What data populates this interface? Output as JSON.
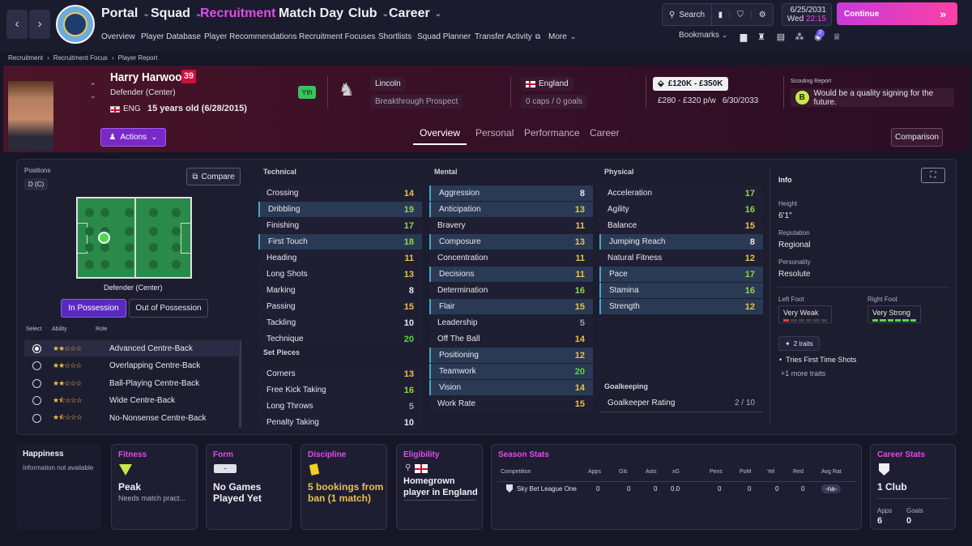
{
  "topnav": {
    "items": [
      "Portal",
      "Squad",
      "Recruitment",
      "Match Day",
      "Club",
      "Career"
    ],
    "subitems": [
      "Overview",
      "Player Database",
      "Player Recommendations",
      "Recruitment Focuses",
      "Shortlists",
      "Squad Planner",
      "Transfer Activity",
      "More"
    ],
    "search": "Search",
    "date": "6/25/2031",
    "day": "Wed",
    "time": "22:15",
    "continue": "Continue",
    "bookmarks": "Bookmarks",
    "badge": "2"
  },
  "breadcrumb": [
    "Recruitment",
    "Recruitment Focus",
    "Player Report"
  ],
  "player": {
    "name": "Harry Harwood",
    "number": "39",
    "position": "Defender (Center)",
    "nation_code": "ENG",
    "age": "15 years old (6/28/2015)",
    "youth_tag": "Yth",
    "club": "Lincoln",
    "status": "Breakthrough Prospect",
    "nation": "England",
    "caps": "0 caps / 0 goals",
    "value": "£120K - £350K",
    "wage": "£280 - £320 p/w",
    "contract": "6/30/2033",
    "actions": "Actions"
  },
  "scout": {
    "label": "Scouting Report",
    "grade": "B",
    "text": "Would be a quality signing for the future."
  },
  "tabs": [
    "Overview",
    "Personal",
    "Performance",
    "Career"
  ],
  "comparison": "Comparison",
  "positions": {
    "label": "Positions",
    "value": "D (C)",
    "compare": "Compare",
    "pitch_label": "Defender (Center)",
    "in_poss": "In Possession",
    "out_poss": "Out of Possession",
    "col_select": "Select",
    "col_ability": "Ability",
    "col_role": "Role",
    "roles": [
      {
        "name": "Advanced Centre-Back",
        "stars": "★★☆☆☆"
      },
      {
        "name": "Overlapping Centre-Back",
        "stars": "★★☆☆☆"
      },
      {
        "name": "Ball-Playing Centre-Back",
        "stars": "★★☆☆☆"
      },
      {
        "name": "Wide Centre-Back",
        "stars": "★⯪☆☆☆"
      },
      {
        "name": "No-Nonsense Centre-Back",
        "stars": "★⯪☆☆☆"
      }
    ]
  },
  "technical": {
    "title": "Technical",
    "rows": [
      [
        "Crossing",
        "14"
      ],
      [
        "Dribbling",
        "19"
      ],
      [
        "Finishing",
        "17"
      ],
      [
        "First Touch",
        "18"
      ],
      [
        "Heading",
        "11"
      ],
      [
        "Long Shots",
        "13"
      ],
      [
        "Marking",
        "8"
      ],
      [
        "Passing",
        "15"
      ],
      [
        "Tackling",
        "10"
      ],
      [
        "Technique",
        "20"
      ]
    ]
  },
  "setpieces": {
    "title": "Set Pieces",
    "rows": [
      [
        "Corners",
        "13"
      ],
      [
        "Free Kick Taking",
        "16"
      ],
      [
        "Long Throws",
        "5"
      ],
      [
        "Penalty Taking",
        "10"
      ]
    ]
  },
  "mental": {
    "title": "Mental",
    "rows": [
      [
        "Aggression",
        "8"
      ],
      [
        "Anticipation",
        "13"
      ],
      [
        "Bravery",
        "11"
      ],
      [
        "Composure",
        "13"
      ],
      [
        "Concentration",
        "11"
      ],
      [
        "Decisions",
        "11"
      ],
      [
        "Determination",
        "16"
      ],
      [
        "Flair",
        "15"
      ],
      [
        "Leadership",
        "5"
      ],
      [
        "Off The Ball",
        "14"
      ],
      [
        "Positioning",
        "12"
      ],
      [
        "Teamwork",
        "20"
      ],
      [
        "Vision",
        "14"
      ],
      [
        "Work Rate",
        "15"
      ]
    ]
  },
  "physical": {
    "title": "Physical",
    "rows": [
      [
        "Acceleration",
        "17"
      ],
      [
        "Agility",
        "16"
      ],
      [
        "Balance",
        "15"
      ],
      [
        "Jumping Reach",
        "8"
      ],
      [
        "Natural Fitness",
        "12"
      ],
      [
        "Pace",
        "17"
      ],
      [
        "Stamina",
        "16"
      ],
      [
        "Strength",
        "12"
      ]
    ]
  },
  "goalkeeping": {
    "title": "Goalkeeping",
    "label": "Goalkeeper Rating",
    "value": "2 / 10"
  },
  "info": {
    "title": "Info",
    "height_label": "Height",
    "height": "6'1\"",
    "rep_label": "Reputation",
    "rep": "Regional",
    "pers_label": "Personality",
    "pers": "Resolute",
    "lf_label": "Left Foot",
    "lf": "Very Weak",
    "rf_label": "Right Foot",
    "rf": "Very Strong",
    "traits_btn": "2 traits",
    "trait1": "Tries First Time Shots",
    "more_traits": "+1 more traits"
  },
  "cards": {
    "happiness": {
      "title": "Happiness",
      "text": "Information not available"
    },
    "fitness": {
      "title": "Fitness",
      "value": "Peak",
      "sub": "Needs match pract..."
    },
    "form": {
      "title": "Form",
      "chip": "-",
      "value": "No Games Played Yet"
    },
    "discipline": {
      "title": "Discipline",
      "value": "5 bookings from ban (1 match)"
    },
    "eligibility": {
      "title": "Eligibility",
      "value": "Homegrown player in England"
    },
    "season": {
      "title": "Season Stats",
      "headers": [
        "Competition",
        "Apps",
        "Gls",
        "Asts",
        "xG",
        "Pens",
        "PoM",
        "Yel",
        "Red",
        "Avg Rat"
      ],
      "row": [
        "Sky Bet League One",
        "0",
        "0",
        "0",
        "0.0",
        "0",
        "0",
        "0",
        "0",
        "-na-"
      ]
    },
    "career": {
      "title": "Career Stats",
      "clubs": "1 Club",
      "apps_label": "Apps",
      "apps": "6",
      "goals_label": "Goals",
      "goals": "0"
    }
  }
}
